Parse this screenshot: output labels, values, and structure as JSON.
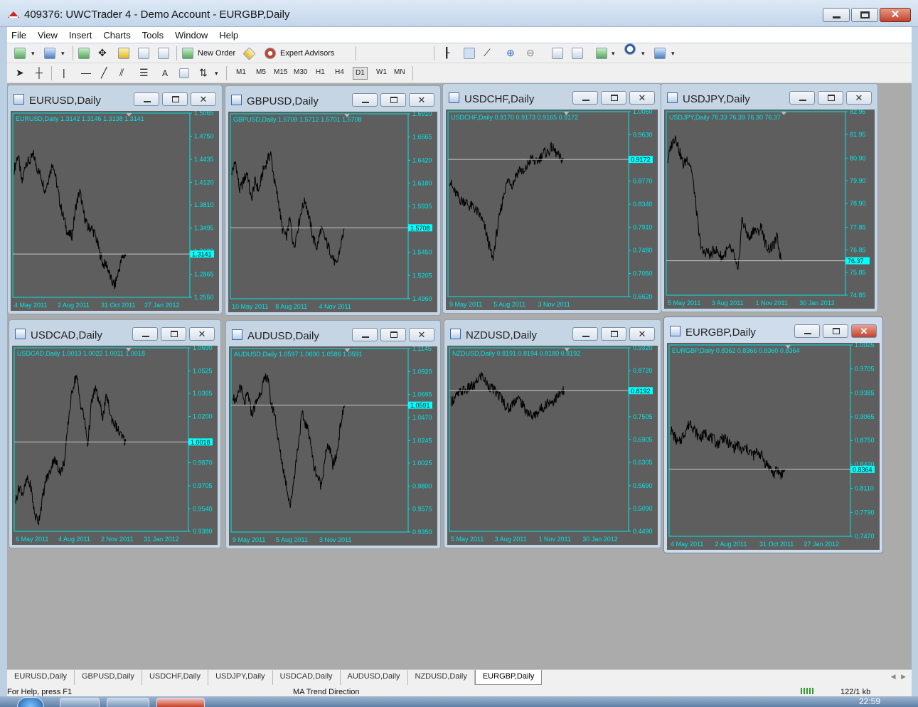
{
  "window": {
    "title": "409376: UWCTrader 4 - Demo Account - EURGBP,Daily"
  },
  "menu": [
    "File",
    "View",
    "Insert",
    "Charts",
    "Tools",
    "Window",
    "Help"
  ],
  "toolbar": {
    "new_order": "New Order",
    "expert_advisors": "Expert Advisors",
    "text_tool": "A",
    "timeframes": [
      "M1",
      "M5",
      "M15",
      "M30",
      "H1",
      "H4",
      "D1",
      "W1",
      "MN"
    ],
    "active_timeframe": "D1"
  },
  "charts": [
    {
      "title": "EURUSD,Daily",
      "ohlc": "EURUSD,Daily  1.3142 1.3146 1.3138 1.3141",
      "price_ticks": [
        "1.5065",
        "1.4750",
        "1.4435",
        "1.4120",
        "1.3810",
        "1.3495",
        "1.3180",
        "1.2865",
        "1.2550"
      ],
      "price_range": [
        1.255,
        1.5065
      ],
      "current_price": "1.3141",
      "date_ticks": [
        "4 May 2011",
        "2 Aug 2011",
        "31 Oct 2011",
        "27 Jan 2012"
      ],
      "trend": [
        1.43,
        1.45,
        1.41,
        1.44,
        1.44,
        1.45,
        1.43,
        1.42,
        1.4,
        1.42,
        1.44,
        1.41,
        1.38,
        1.36,
        1.34,
        1.34,
        1.38,
        1.4,
        1.37,
        1.35,
        1.35,
        1.34,
        1.32,
        1.3,
        1.3,
        1.28,
        1.27,
        1.29,
        1.31,
        1.314
      ],
      "line_color": "#000000"
    },
    {
      "title": "GBPUSD,Daily",
      "ohlc": "GBPUSD,Daily  1.5709 1.5712 1.5701 1.5708",
      "price_ticks": [
        "1.6910",
        "1.6665",
        "1.6420",
        "1.6180",
        "1.5935",
        "1.5708",
        "1.5450",
        "1.5205",
        "1.4960"
      ],
      "price_range": [
        1.496,
        1.691
      ],
      "current_price": "1.5708",
      "date_ticks": [
        "10 May 2011",
        "8 Aug 2011",
        "4 Nov 2011"
      ],
      "trend": [
        1.63,
        1.64,
        1.61,
        1.62,
        1.63,
        1.6,
        1.62,
        1.61,
        1.63,
        1.64,
        1.65,
        1.62,
        1.6,
        1.57,
        1.56,
        1.58,
        1.55,
        1.57,
        1.59,
        1.6,
        1.58,
        1.56,
        1.55,
        1.57,
        1.56,
        1.55,
        1.54,
        1.53,
        1.55,
        1.57
      ],
      "line_color": "#000000"
    },
    {
      "title": "USDCHF,Daily",
      "ohlc": "USDCHF,Daily  0.9170 0.9173 0.9165 0.9172",
      "price_ticks": [
        "1.0060",
        "0.9630",
        "0.9172",
        "0.8770",
        "0.8340",
        "0.7910",
        "0.7480",
        "0.7050",
        "0.6620"
      ],
      "price_range": [
        0.662,
        1.006
      ],
      "current_price": "0.9172",
      "date_ticks": [
        "9 May 2011",
        "5 Aug 2011",
        "3 Nov 2011"
      ],
      "trend": [
        0.88,
        0.86,
        0.85,
        0.84,
        0.84,
        0.83,
        0.83,
        0.82,
        0.81,
        0.79,
        0.76,
        0.73,
        0.78,
        0.82,
        0.86,
        0.88,
        0.87,
        0.89,
        0.9,
        0.89,
        0.91,
        0.92,
        0.91,
        0.92,
        0.93,
        0.93,
        0.94,
        0.93,
        0.92,
        0.917
      ],
      "line_color": "#000000"
    },
    {
      "title": "USDJPY,Daily",
      "ohlc": "USDJPY,Daily  76.33 76.39 76.30 76.37",
      "price_ticks": [
        "82.95",
        "81.95",
        "80.90",
        "79.90",
        "78.90",
        "77.85",
        "76.85",
        "75.85",
        "74.85"
      ],
      "price_range": [
        74.85,
        82.95
      ],
      "current_price": "76.37",
      "date_ticks": [
        "5 May 2011",
        "3 Aug 2011",
        "1 Nov 2011",
        "30 Jan 2012"
      ],
      "trend": [
        80.8,
        81.5,
        81.9,
        81.2,
        80.6,
        80.9,
        80.5,
        79.2,
        77.5,
        76.7,
        76.8,
        76.6,
        76.9,
        76.7,
        76.5,
        76.8,
        76.9,
        76.6,
        75.8,
        78.2,
        77.7,
        77.3,
        77.8,
        77.6,
        77.9,
        77.1,
        76.9,
        77.0,
        77.4,
        76.4
      ],
      "line_color": "#000000"
    },
    {
      "title": "USDCAD,Daily",
      "ohlc": "USDCAD,Daily  1.0013 1.0022 1.0011 1.0018",
      "price_ticks": [
        "1.0690",
        "1.0525",
        "1.0365",
        "1.0200",
        "1.0018",
        "0.9870",
        "0.9705",
        "0.9540",
        "0.9380"
      ],
      "price_range": [
        0.938,
        1.069
      ],
      "current_price": "1.0018",
      "date_ticks": [
        "6 May 2011",
        "4 Aug 2011",
        "2 Nov 2011",
        "31 Jan 2012"
      ],
      "trend": [
        0.96,
        0.97,
        0.965,
        0.975,
        0.97,
        0.95,
        0.945,
        0.96,
        0.975,
        0.98,
        0.99,
        0.985,
        0.98,
        0.99,
        1.02,
        1.04,
        1.05,
        1.03,
        1.02,
        1.0,
        1.03,
        1.04,
        1.03,
        1.02,
        1.035,
        1.02,
        1.015,
        1.01,
        1.005,
        1.0018
      ],
      "line_color": "#000000"
    },
    {
      "title": "AUDUSD,Daily",
      "ohlc": "AUDUSD,Daily  1.0597 1.0600 1.0586 1.0591",
      "price_ticks": [
        "1.1145",
        "1.0920",
        "1.0695",
        "1.0591",
        "1.0470",
        "1.0245",
        "1.0025",
        "0.9800",
        "0.9575",
        "0.9350"
      ],
      "price_range": [
        0.935,
        1.1145
      ],
      "current_price": "1.0591",
      "date_ticks": [
        "9 May 2011",
        "5 Aug 2011",
        "3 Nov 2011"
      ],
      "trend": [
        1.07,
        1.06,
        1.08,
        1.06,
        1.07,
        1.05,
        1.06,
        1.07,
        1.08,
        1.09,
        1.06,
        1.05,
        1.02,
        1.0,
        0.98,
        0.96,
        0.99,
        1.02,
        1.05,
        1.04,
        1.03,
        1.0,
        0.99,
        0.98,
        1.01,
        1.02,
        1.0,
        1.01,
        1.04,
        1.059
      ],
      "line_color": "#000000"
    },
    {
      "title": "NZDUSD,Daily",
      "ohlc": "NZDUSD,Daily  0.8191 0.8194 0.8180 0.8192",
      "price_ticks": [
        "0.9320",
        "0.8720",
        "0.8192",
        "0.7505",
        "0.6905",
        "0.6305",
        "0.5690",
        "0.5090",
        "0.4490"
      ],
      "price_range": [
        0.449,
        0.932
      ],
      "current_price": "0.8192",
      "date_ticks": [
        "5 May 2011",
        "3 Aug 2011",
        "1 Nov 2011",
        "30 Jan 2012"
      ],
      "trend": [
        0.79,
        0.8,
        0.81,
        0.82,
        0.82,
        0.83,
        0.83,
        0.85,
        0.86,
        0.84,
        0.83,
        0.82,
        0.81,
        0.8,
        0.78,
        0.77,
        0.79,
        0.8,
        0.79,
        0.77,
        0.76,
        0.75,
        0.76,
        0.77,
        0.78,
        0.79,
        0.79,
        0.8,
        0.81,
        0.819
      ],
      "line_color": "#000000"
    },
    {
      "title": "EURGBP,Daily",
      "ohlc": "EURGBP,Daily  0.8362 0.8366 0.8360 0.8364",
      "price_ticks": [
        "1.0025",
        "0.9705",
        "0.9385",
        "0.9065",
        "0.8750",
        "0.8430",
        "0.8110",
        "0.7790",
        "0.7470"
      ],
      "price_range": [
        0.747,
        1.0025
      ],
      "current_price": "0.8364",
      "date_ticks": [
        "4 May 2011",
        "2 Aug 2011",
        "31 Oct 2011",
        "27 Jan 2012"
      ],
      "trend": [
        0.89,
        0.88,
        0.87,
        0.88,
        0.89,
        0.9,
        0.89,
        0.88,
        0.88,
        0.885,
        0.88,
        0.875,
        0.87,
        0.88,
        0.875,
        0.87,
        0.865,
        0.87,
        0.86,
        0.865,
        0.86,
        0.855,
        0.86,
        0.855,
        0.845,
        0.84,
        0.83,
        0.835,
        0.83,
        0.836
      ],
      "line_color": "#000000"
    }
  ],
  "tabs": [
    "EURUSD,Daily",
    "GBPUSD,Daily",
    "USDCHF,Daily",
    "USDJPY,Daily",
    "USDCAD,Daily",
    "AUDUSD,Daily",
    "NZDUSD,Daily",
    "EURGBP,Daily"
  ],
  "active_tab": "EURGBP,Daily",
  "status": {
    "help": "For Help, press F1",
    "profile": "MA Trend Direction",
    "traffic": "122/1 kb"
  },
  "taskbar": {
    "clock": "22:59"
  },
  "colors": {
    "chart_bg": "#5e5e5e",
    "chart_frame": "#00e5e5",
    "price_tag": "#00ffff",
    "close_red": "#c2432c"
  }
}
